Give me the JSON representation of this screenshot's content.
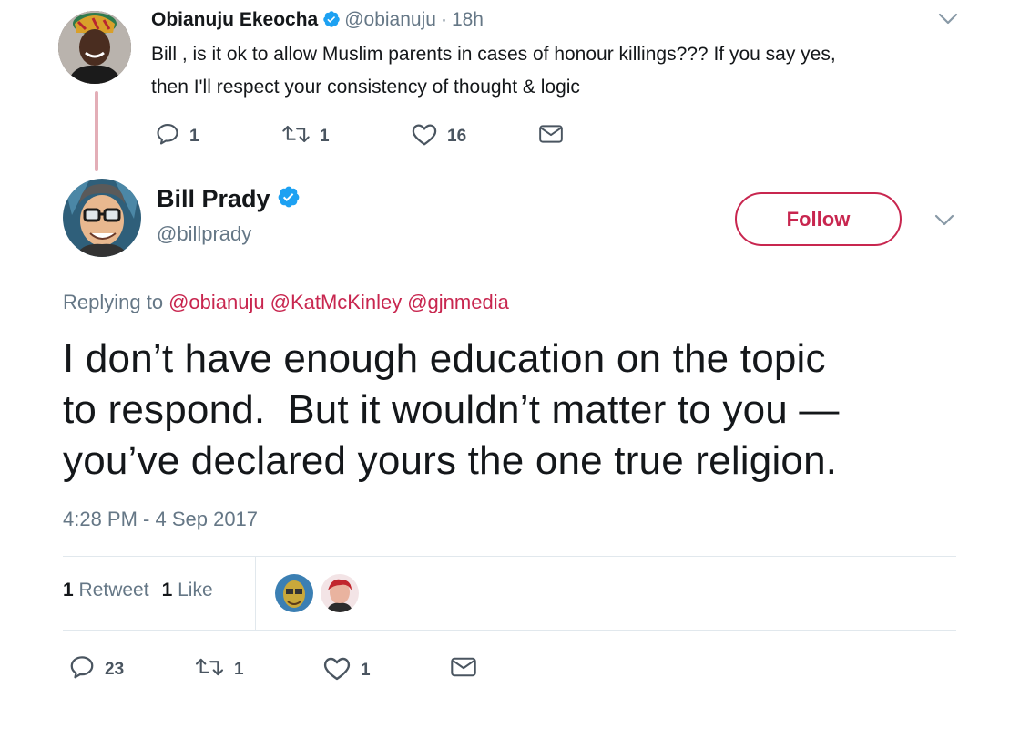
{
  "parent_tweet": {
    "author_name": "Obianuju Ekeocha",
    "author_handle": "@obianuju",
    "separator": "·",
    "time": "18h",
    "text_lines": [
      "Bill , is it ok to allow Muslim parents in cases of honour killings??? If you say yes,",
      "then I'll respect your consistency of thought & logic"
    ],
    "actions": {
      "reply_count": "1",
      "retweet_count": "1",
      "like_count": "16"
    }
  },
  "main_tweet": {
    "author_name": "Bill Prady",
    "author_handle": "@billprady",
    "follow_label": "Follow",
    "replying_to_label": "Replying to",
    "replying_to": [
      "@obianuju",
      "@KatMcKinley",
      "@gjnmedia"
    ],
    "text_lines": [
      "I don’t have enough education on the topic",
      "to respond.  But it wouldn’t matter to you —",
      "you’ve declared yours the one true religion."
    ],
    "timestamp": "4:28 PM - 4 Sep 2017",
    "stats": {
      "retweets_count": "1",
      "retweets_label": "Retweet",
      "likes_count": "1",
      "likes_label": "Like"
    },
    "actions": {
      "reply_count": "23",
      "retweet_count": "1",
      "like_count": "1"
    }
  },
  "colors": {
    "accent": "#c8264f",
    "verified": "#1da1f2",
    "muted_text": "#657786",
    "thread_line": "#e3aeb7",
    "divider": "#e1e8ed"
  },
  "icons": [
    "reply-icon",
    "retweet-icon",
    "like-icon",
    "message-icon",
    "verified-badge-icon",
    "chevron-down-icon"
  ]
}
